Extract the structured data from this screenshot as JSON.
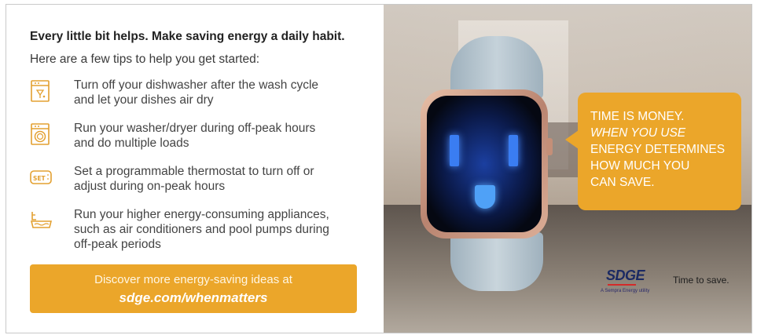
{
  "headline": "Every little bit helps. Make saving energy a daily habit.",
  "intro": "Here are a few tips to help you get started:",
  "tips": [
    {
      "icon": "dishwasher-icon",
      "lines": [
        "Turn off your dishwasher after the wash cycle",
        "and let your dishes air dry"
      ]
    },
    {
      "icon": "washer-icon",
      "lines": [
        "Run your washer/dryer during off-peak hours",
        "and do multiple loads"
      ]
    },
    {
      "icon": "thermostat-icon",
      "lines": [
        "Set a programmable thermostat to turn off or",
        "adjust during on-peak hours"
      ]
    },
    {
      "icon": "pool-pump-icon",
      "lines": [
        "Run your higher energy-consuming appliances,",
        "such as air conditioners and pool pumps during",
        "off-peak periods"
      ]
    }
  ],
  "cta": {
    "line1": "Discover more energy-saving ideas at",
    "line2": "sdge.com/whenmatters"
  },
  "bubble": {
    "lines": [
      "TIME IS MONEY.",
      "WHEN YOU USE",
      "ENERGY DETERMINES",
      "HOW MUCH YOU",
      "CAN SAVE."
    ]
  },
  "brand": {
    "logo": "SDGE",
    "sub": "A Sempra Energy utility",
    "tagline": "Time to save."
  },
  "thermostat_label": "SET",
  "colors": {
    "accent": "#eba62a",
    "icon": "#e3a030"
  }
}
